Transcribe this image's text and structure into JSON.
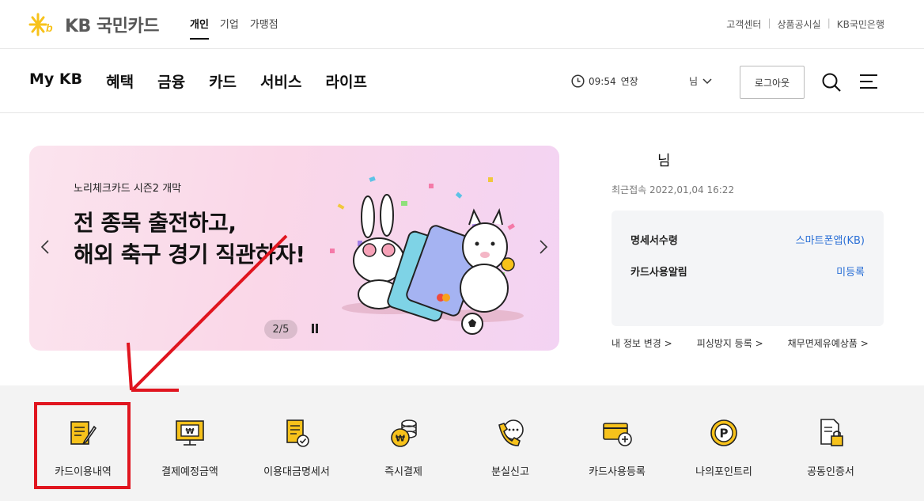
{
  "brand": {
    "name": "국민카드",
    "abbr": "KB"
  },
  "segments": [
    {
      "label": "개인",
      "active": true
    },
    {
      "label": "기업",
      "active": false
    },
    {
      "label": "가맹점",
      "active": false
    }
  ],
  "util_links": [
    "고객센터",
    "상품공시실",
    "KB국민은행"
  ],
  "gnb": [
    "My KB",
    "혜택",
    "금융",
    "카드",
    "서비스",
    "라이프"
  ],
  "session": {
    "time": "09:54",
    "extend_label": "연장"
  },
  "user_menu": {
    "label": "님"
  },
  "logout_label": "로그아웃",
  "banner": {
    "subtitle": "노리체크카드 시즌2 개막",
    "title_line1": "전 종목 출전하고,",
    "title_line2": "해외 축구 경기 직관하자!",
    "counter": "2/5",
    "prev_icon": "chevron-left-icon",
    "next_icon": "chevron-right-icon"
  },
  "account": {
    "name": "님",
    "last_login": "최근접속 2022,01,04 16:22",
    "rows": [
      {
        "key": "명세서수령",
        "value": "스마트폰앱(KB)"
      },
      {
        "key": "카드사용알림",
        "value": "미등록"
      }
    ],
    "links": [
      "내 정보 변경 >",
      "피싱방지 등록 >",
      "채무면제유예상품 >"
    ]
  },
  "quick_menu": [
    {
      "label": "카드이용내역",
      "icon": "document-pen-icon"
    },
    {
      "label": "결제예정금액",
      "icon": "monitor-won-icon"
    },
    {
      "label": "이용대금명세서",
      "icon": "statement-check-icon"
    },
    {
      "label": "즉시결제",
      "icon": "coin-stack-icon"
    },
    {
      "label": "분실신고",
      "icon": "phone-call-icon"
    },
    {
      "label": "카드사용등록",
      "icon": "card-plus-icon"
    },
    {
      "label": "나의포인트리",
      "icon": "point-icon"
    },
    {
      "label": "공동인증서",
      "icon": "certificate-lock-icon"
    }
  ],
  "colors": {
    "accent_yellow": "#f7c21b",
    "link_blue": "#2a6fd6",
    "annotation_red": "#e0151f"
  }
}
